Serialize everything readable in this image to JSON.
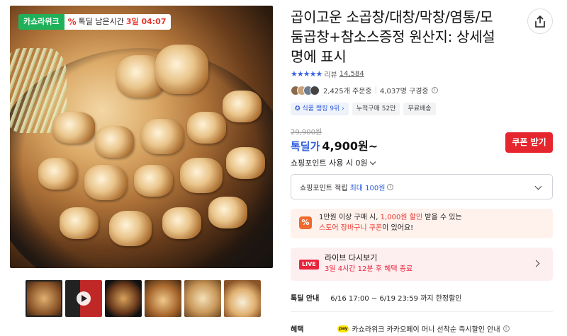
{
  "badges": {
    "deal_label": "카쇼라위크",
    "timer_prefix": "톡딜 남은시간",
    "timer_value": "3일 04:07"
  },
  "product": {
    "title": "곱이고운 소곱창/대창/막창/염통/모둠곱창+참소스증정 원산지: 상세설명에 표시",
    "rating_stars": 4.5,
    "review_label": "리뷰",
    "review_count": "14,584",
    "orders": "2,425개 주문중",
    "subscribers": "4,037명 구경중"
  },
  "chips": [
    "식품 랭킹 9위",
    "누적구매 52만",
    "무료배송"
  ],
  "price": {
    "original": "29,900원",
    "label": "톡딜가",
    "value": "4,900원~",
    "coupon_button": "쿠폰 받기"
  },
  "points": {
    "use_label": "쇼핑포인트 사용 시 0원",
    "earn_label": "쇼핑포인트 적립",
    "earn_max": "최대 100원"
  },
  "cart_coupon": {
    "line1_a": "1만원 이상 구매 시,",
    "line1_b": "1,000원 할인",
    "line1_c": "받을 수 있는",
    "line2_a": "스토어 장바구니 쿠폰",
    "line2_b": "이 있어요!"
  },
  "live": {
    "tag": "LIVE",
    "title": "라이브 다시보기",
    "sub": "3일 4시간 12분 후 혜택 종료"
  },
  "deal_info": {
    "label": "톡딜 안내",
    "text": "6/16 17:00 ~ 6/19 23:59 까지 한정할인"
  },
  "benefit": {
    "label": "혜택",
    "pay_badge": "pay",
    "text": "카쇼라위크 카카오페이 머니 선착순 즉시할인 안내"
  },
  "colors": {
    "accent_blue": "#2f5de0",
    "accent_red": "#e6262e",
    "deal_green": "#1fb15a"
  }
}
